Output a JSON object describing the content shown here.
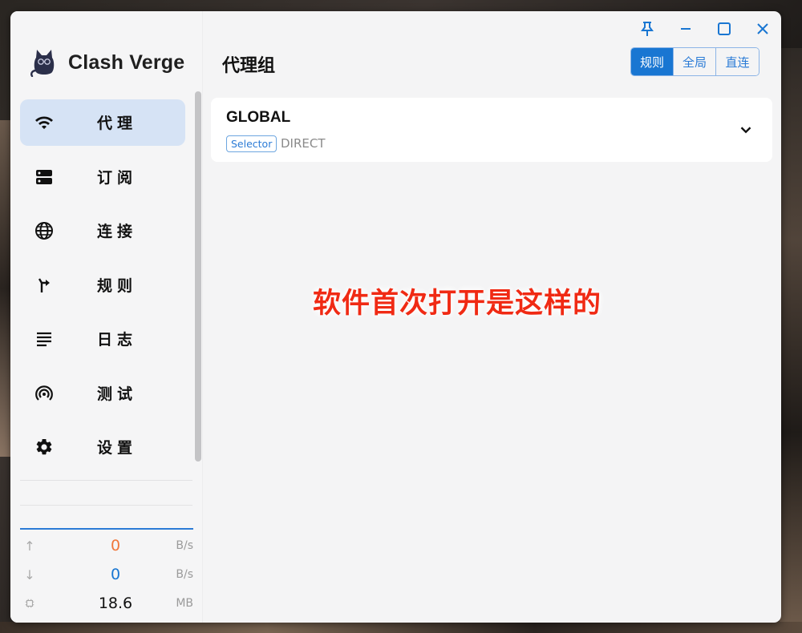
{
  "app": {
    "name": "Clash Verge"
  },
  "sidebar": {
    "items": [
      {
        "label": "代理",
        "icon": "wifi-icon",
        "active": true
      },
      {
        "label": "订阅",
        "icon": "storage-icon",
        "active": false
      },
      {
        "label": "连接",
        "icon": "globe-icon",
        "active": false
      },
      {
        "label": "规则",
        "icon": "fork-arrow-icon",
        "active": false
      },
      {
        "label": "日志",
        "icon": "text-lines-icon",
        "active": false
      },
      {
        "label": "测试",
        "icon": "signal-icon",
        "active": false
      },
      {
        "label": "设置",
        "icon": "gear-icon",
        "active": false
      }
    ]
  },
  "traffic": {
    "upload": {
      "value": "0",
      "unit": "B/s",
      "color": "#f0773a"
    },
    "download": {
      "value": "0",
      "unit": "B/s",
      "color": "#1976d2"
    },
    "memory": {
      "value": "18.6",
      "unit": "MB",
      "color": "#111111"
    }
  },
  "main": {
    "title": "代理组",
    "modes": [
      {
        "label": "规则",
        "active": true
      },
      {
        "label": "全局",
        "active": false
      },
      {
        "label": "直连",
        "active": false
      }
    ],
    "groups": [
      {
        "name": "GLOBAL",
        "type": "Selector",
        "now": "DIRECT"
      }
    ]
  },
  "annotation": {
    "text": "软件首次打开是这样的",
    "color": "#f02a14"
  },
  "colors": {
    "accent": "#1976d2",
    "active_nav_bg": "#d6e3f5"
  }
}
